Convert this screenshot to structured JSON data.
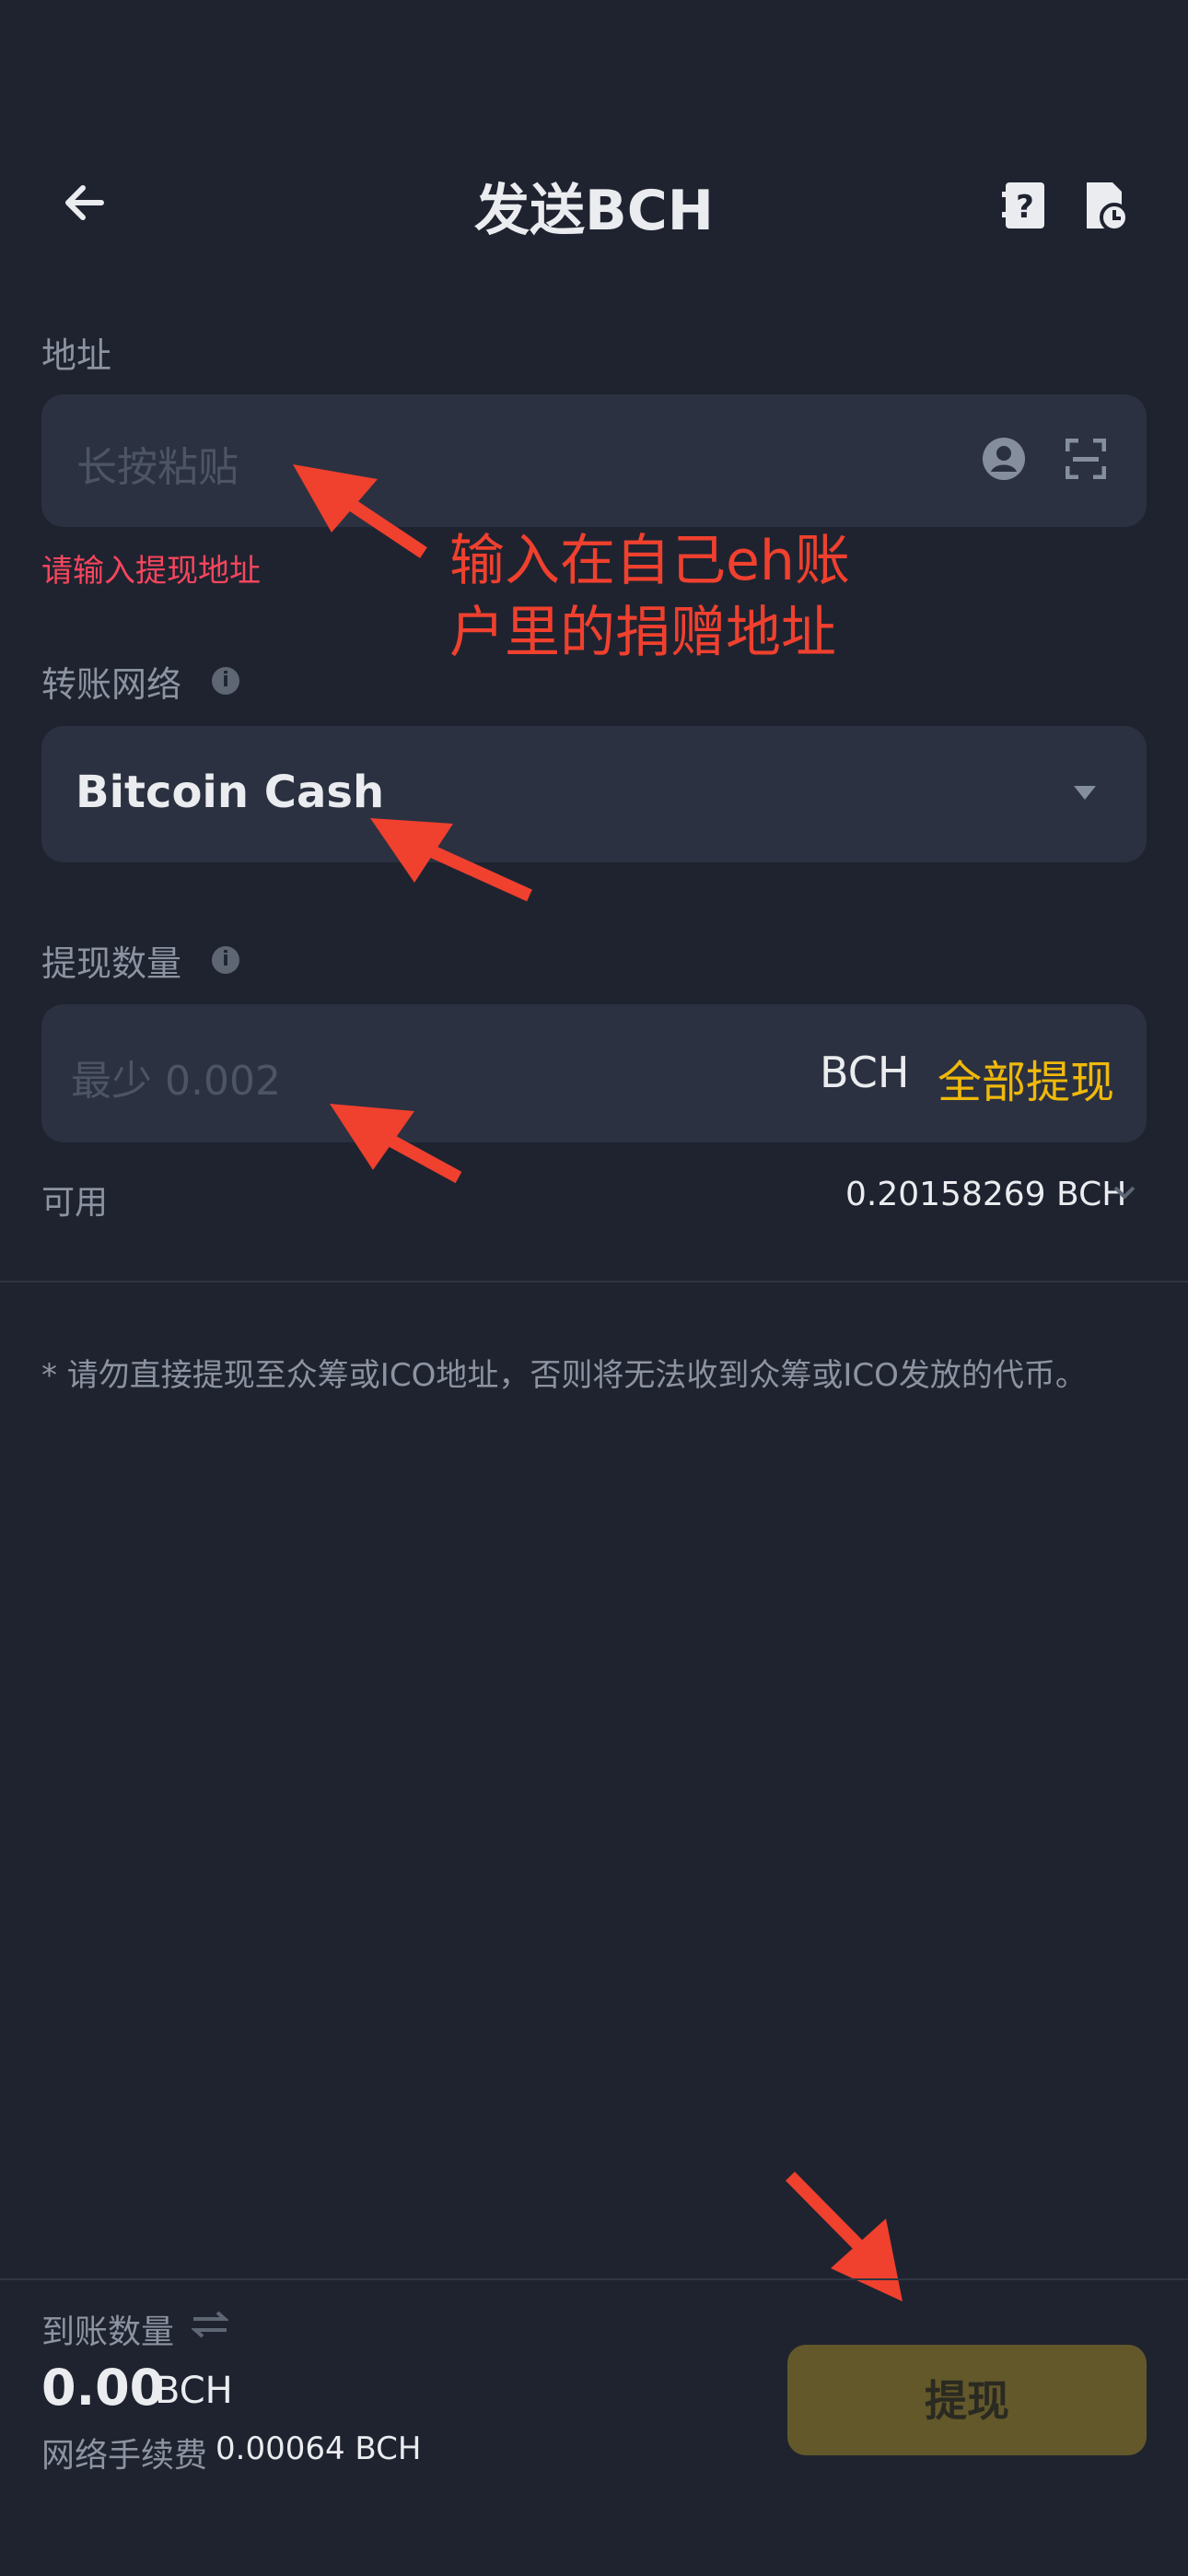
{
  "header": {
    "title": "发送BCH",
    "back_icon": "arrow-left-icon",
    "help_icon": "book-question-icon",
    "history_icon": "document-clock-icon"
  },
  "address": {
    "label": "地址",
    "placeholder": "长按粘贴",
    "error": "请输入提现地址",
    "contacts_icon": "user-circle-icon",
    "scan_icon": "scan-icon"
  },
  "annotation": {
    "line1": "输入在自己eh账",
    "line2": "户里的捐赠地址"
  },
  "network": {
    "label": "转账网络",
    "value": "Bitcoin Cash",
    "info_icon": "info-icon",
    "dropdown_icon": "caret-down-icon"
  },
  "amount": {
    "label": "提现数量",
    "placeholder": "最少 0.002",
    "unit": "BCH",
    "max_label": "全部提现",
    "info_icon": "info-icon"
  },
  "available": {
    "label": "可用",
    "value": "0.20158269 BCH",
    "chevron_icon": "chevron-down-icon"
  },
  "warning": "* 请勿直接提现至众筹或ICO地址，否则将无法收到众筹或ICO发放的代币。",
  "footer": {
    "receive_label": "到账数量",
    "swap_icon": "swap-arrows-icon",
    "receive_amount": "0.00",
    "receive_unit": "BCH",
    "fee_label": "网络手续费",
    "fee_value": "0.00064 BCH",
    "withdraw_button": "提现"
  },
  "colors": {
    "background": "#1f2330",
    "field": "#2b3140",
    "accent": "#f0b90b",
    "error": "#f6465d",
    "annotation": "#f0402e",
    "button_disabled": "#63582a"
  }
}
